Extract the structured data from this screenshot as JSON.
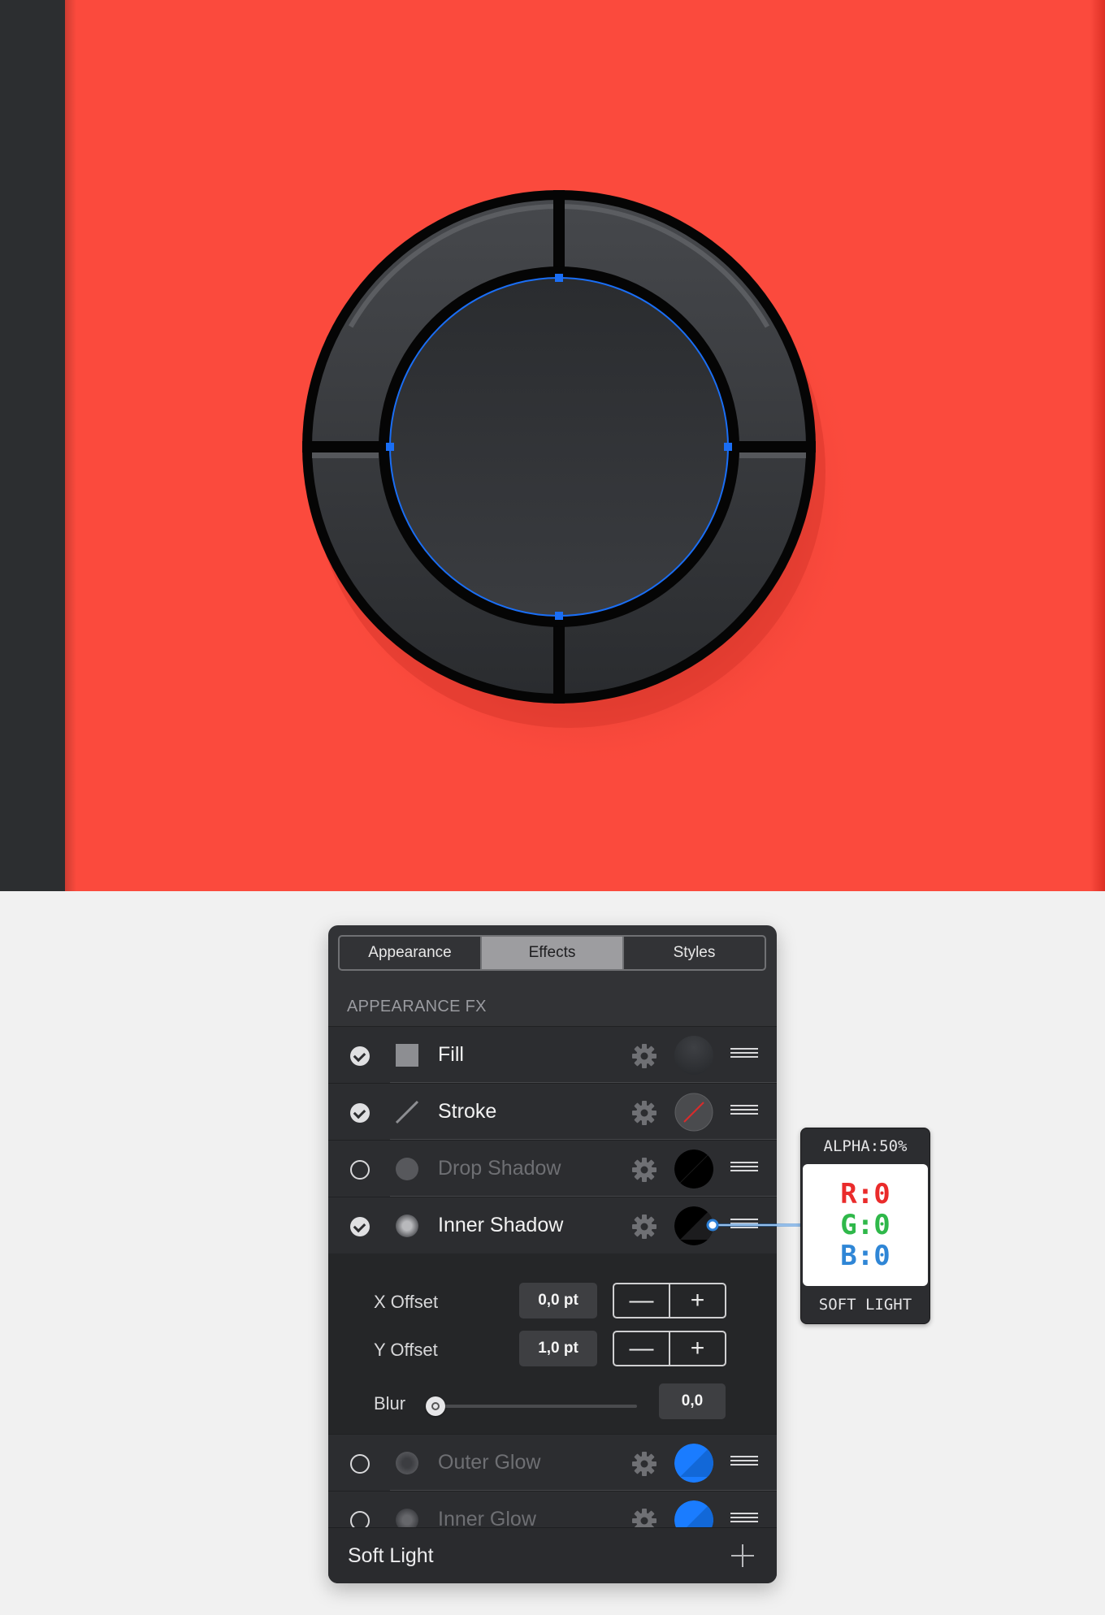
{
  "canvas": {
    "background_color": "#fb4a3d",
    "sidebar_color": "#2c2e30",
    "object": "knob-circle",
    "selection_color": "#1a6ef5"
  },
  "panel": {
    "tabs": [
      {
        "label": "Appearance",
        "active": false
      },
      {
        "label": "Effects",
        "active": true
      },
      {
        "label": "Styles",
        "active": false
      }
    ],
    "section_label": "APPEARANCE FX",
    "effects": [
      {
        "label": "Fill",
        "enabled": true,
        "icon": "fill-square-icon",
        "swatch": "dark-gradient"
      },
      {
        "label": "Stroke",
        "enabled": true,
        "icon": "stroke-line-icon",
        "swatch": "none-slash"
      },
      {
        "label": "Drop Shadow",
        "enabled": false,
        "icon": "shadow-dot-icon",
        "swatch": "black-half"
      },
      {
        "label": "Inner Shadow",
        "enabled": true,
        "icon": "shadow-dot-icon",
        "swatch": "black-half"
      },
      {
        "label": "Outer Glow",
        "enabled": false,
        "icon": "glow-dot-icon",
        "swatch": "blue-half"
      },
      {
        "label": "Inner Glow",
        "enabled": false,
        "icon": "glow-dot-icon",
        "swatch": "blue-half"
      }
    ],
    "details": {
      "x_offset_label": "X Offset",
      "x_offset_value": "0,0 pt",
      "y_offset_label": "Y Offset",
      "y_offset_value": "1,0 pt",
      "blur_label": "Blur",
      "blur_value": "0,0",
      "blur_level": 0
    },
    "footer_label": "Soft Light",
    "accent_color": "#1a7cff"
  },
  "callout": {
    "top": "ALPHA:50%",
    "r": "R:0",
    "g": "G:0",
    "b": "B:0",
    "bottom": "SOFT LIGHT"
  }
}
